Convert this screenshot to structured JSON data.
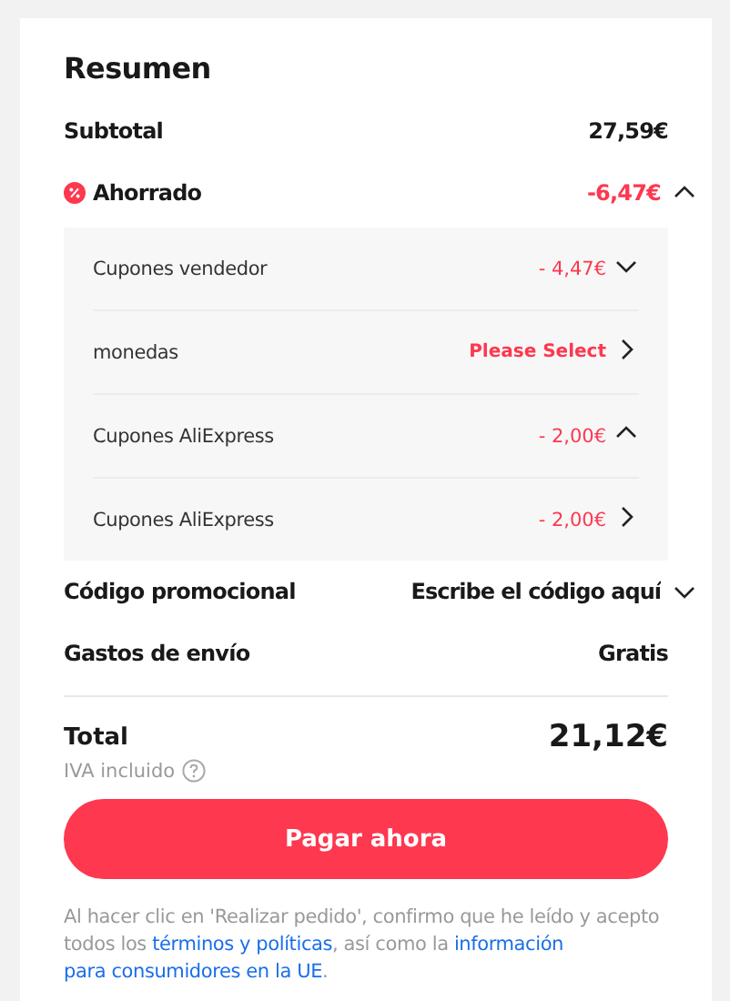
{
  "title": "Resumen",
  "subtotal": {
    "label": "Subtotal",
    "value": "27,59€"
  },
  "savings": {
    "label": "Ahorrado",
    "value": "-6,47€",
    "expanded": true,
    "items": [
      {
        "label": "Cupones vendedor",
        "kind": "amount",
        "value": "- 4,47€",
        "expandable": true,
        "expanded": false
      },
      {
        "label": "monedas",
        "kind": "action",
        "value": "Please Select",
        "expandable": false
      },
      {
        "label": "Cupones AliExpress",
        "kind": "amount",
        "value": "- 2,00€",
        "expandable": true,
        "expanded": true
      },
      {
        "label": "Cupones AliExpress",
        "kind": "amount",
        "value": "- 2,00€",
        "expandable": false
      }
    ]
  },
  "promo": {
    "label": "Código promocional",
    "placeholder": "Escribe el código aquí"
  },
  "shipping": {
    "label": "Gastos de envío",
    "value": "Gratis"
  },
  "total": {
    "label": "Total",
    "value": "21,12€",
    "note": "IVA incluido"
  },
  "pay_button": "Pagar ahora",
  "legal": [
    {
      "kind": "text",
      "text": "Al hacer clic en 'Realizar pedido', confirmo que he leído y acepto todos los "
    },
    {
      "kind": "link",
      "text": "términos y políticas"
    },
    {
      "kind": "text",
      "text": ", así como la "
    },
    {
      "kind": "link",
      "text": "información"
    },
    {
      "kind": "link",
      "text": "para consumidores en la UE"
    },
    {
      "kind": "text",
      "text": "."
    }
  ]
}
